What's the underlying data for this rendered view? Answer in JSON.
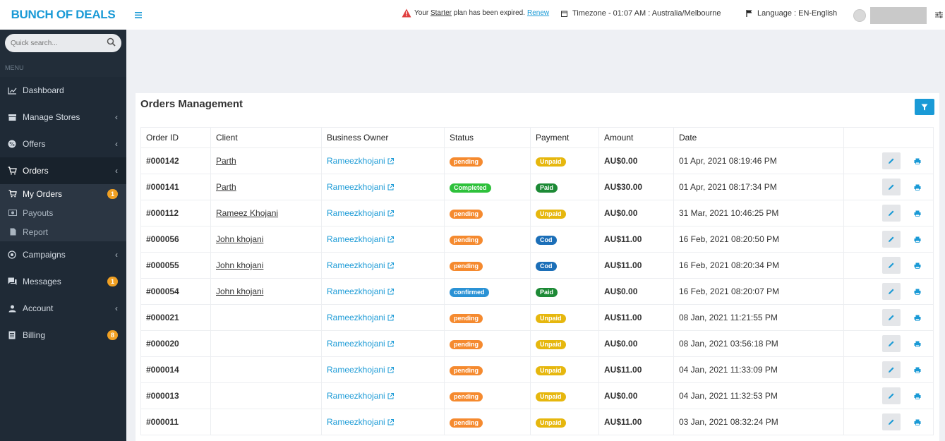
{
  "brand": "BUNCH OF DEALS",
  "search": {
    "placeholder": "Quick search..."
  },
  "menu_label": "MENU",
  "nav": {
    "dashboard": "Dashboard",
    "manage_stores": "Manage Stores",
    "offers": "Offers",
    "orders": "Orders",
    "my_orders": "My Orders",
    "my_orders_badge": "1",
    "payouts": "Payouts",
    "report": "Report",
    "campaigns": "Campaigns",
    "messages": "Messages",
    "messages_badge": "1",
    "account": "Account",
    "billing": "Billing",
    "billing_badge": "8"
  },
  "header": {
    "alert_prefix": "Your ",
    "alert_plan": "Starter",
    "alert_suffix": " plan has been expired.",
    "renew": "Renew",
    "timezone": "Timezone - 01:07 AM : Australia/Melbourne",
    "language": "Language : EN-English"
  },
  "card": {
    "title": "Orders Management"
  },
  "columns": [
    "Order ID",
    "Client",
    "Business Owner",
    "Status",
    "Payment",
    "Amount",
    "Date"
  ],
  "orders": [
    {
      "id": "#000142",
      "client": "Parth",
      "owner": "Rameezkhojani",
      "status": "pending",
      "payment": "Unpaid",
      "amount": "AU$0.00",
      "date": "01 Apr, 2021 08:19:46 PM"
    },
    {
      "id": "#000141",
      "client": "Parth",
      "owner": "Rameezkhojani",
      "status": "Completed",
      "payment": "Paid",
      "amount": "AU$30.00",
      "date": "01 Apr, 2021 08:17:34 PM"
    },
    {
      "id": "#000112",
      "client": "Rameez Khojani",
      "owner": "Rameezkhojani",
      "status": "pending",
      "payment": "Unpaid",
      "amount": "AU$0.00",
      "date": "31 Mar, 2021 10:46:25 PM"
    },
    {
      "id": "#000056",
      "client": "John khojani",
      "owner": "Rameezkhojani",
      "status": "pending",
      "payment": "Cod",
      "amount": "AU$11.00",
      "date": "16 Feb, 2021 08:20:50 PM"
    },
    {
      "id": "#000055",
      "client": "John khojani",
      "owner": "Rameezkhojani",
      "status": "pending",
      "payment": "Cod",
      "amount": "AU$11.00",
      "date": "16 Feb, 2021 08:20:34 PM"
    },
    {
      "id": "#000054",
      "client": "John khojani",
      "owner": "Rameezkhojani",
      "status": "confirmed",
      "payment": "Paid",
      "amount": "AU$0.00",
      "date": "16 Feb, 2021 08:20:07 PM"
    },
    {
      "id": "#000021",
      "client": "",
      "owner": "Rameezkhojani",
      "status": "pending",
      "payment": "Unpaid",
      "amount": "AU$11.00",
      "date": "08 Jan, 2021 11:21:55 PM"
    },
    {
      "id": "#000020",
      "client": "",
      "owner": "Rameezkhojani",
      "status": "pending",
      "payment": "Unpaid",
      "amount": "AU$0.00",
      "date": "08 Jan, 2021 03:56:18 PM"
    },
    {
      "id": "#000014",
      "client": "",
      "owner": "Rameezkhojani",
      "status": "pending",
      "payment": "Unpaid",
      "amount": "AU$11.00",
      "date": "04 Jan, 2021 11:33:09 PM"
    },
    {
      "id": "#000013",
      "client": "",
      "owner": "Rameezkhojani",
      "status": "pending",
      "payment": "Unpaid",
      "amount": "AU$0.00",
      "date": "04 Jan, 2021 11:32:53 PM"
    },
    {
      "id": "#000011",
      "client": "",
      "owner": "Rameezkhojani",
      "status": "pending",
      "payment": "Unpaid",
      "amount": "AU$11.00",
      "date": "03 Jan, 2021 08:32:24 PM"
    }
  ],
  "colors": {
    "accent": "#1a9ad6",
    "sidebar_bg": "#1f2a36",
    "pending": "#f58a2f",
    "completed": "#2ec13b",
    "confirmed": "#2a92d5",
    "unpaid": "#e6b70e",
    "paid": "#1d8a36",
    "cod": "#1c6fb8",
    "badge": "#f0a023"
  },
  "icons": {
    "menu": "hamburger-icon",
    "alert": "warning-icon",
    "timezone": "calendar-icon",
    "language": "flag-icon",
    "settings": "sliders-icon",
    "filter": "filter-icon",
    "edit": "pencil-icon",
    "print": "printer-icon",
    "external": "external-link-icon"
  }
}
